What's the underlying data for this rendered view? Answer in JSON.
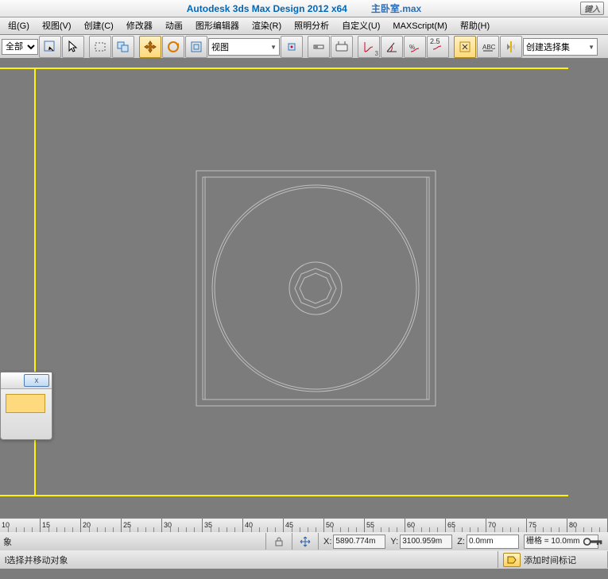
{
  "title": {
    "app": "Autodesk 3ds Max Design 2012 x64",
    "file": "主卧室.max",
    "ext_btn": "键入"
  },
  "menu": [
    "组(G)",
    "视图(V)",
    "创建(C)",
    "修改器",
    "动画",
    "图形编辑器",
    "渲染(R)",
    "照明分析",
    "自定义(U)",
    "MAXScript(M)",
    "帮助(H)"
  ],
  "toolbar": {
    "filter_select": "全部",
    "ref_combo": "视图",
    "named_sel": "创建选择集",
    "spinner": "2.5"
  },
  "palette": {
    "close": "x"
  },
  "ruler": {
    "start": 10,
    "step": 5,
    "count": 15
  },
  "status": {
    "left2": "象",
    "lock_icon": "lock",
    "axis_icon": "axis",
    "x_label": "X:",
    "x": "5890.774m",
    "y_label": "Y:",
    "y": "3100.959m",
    "z_label": "Z:",
    "z": "0.0mm",
    "grid": "栅格 = 10.0mm",
    "hint": "l选择并移动对象",
    "tag_label": "添加时间标记"
  }
}
